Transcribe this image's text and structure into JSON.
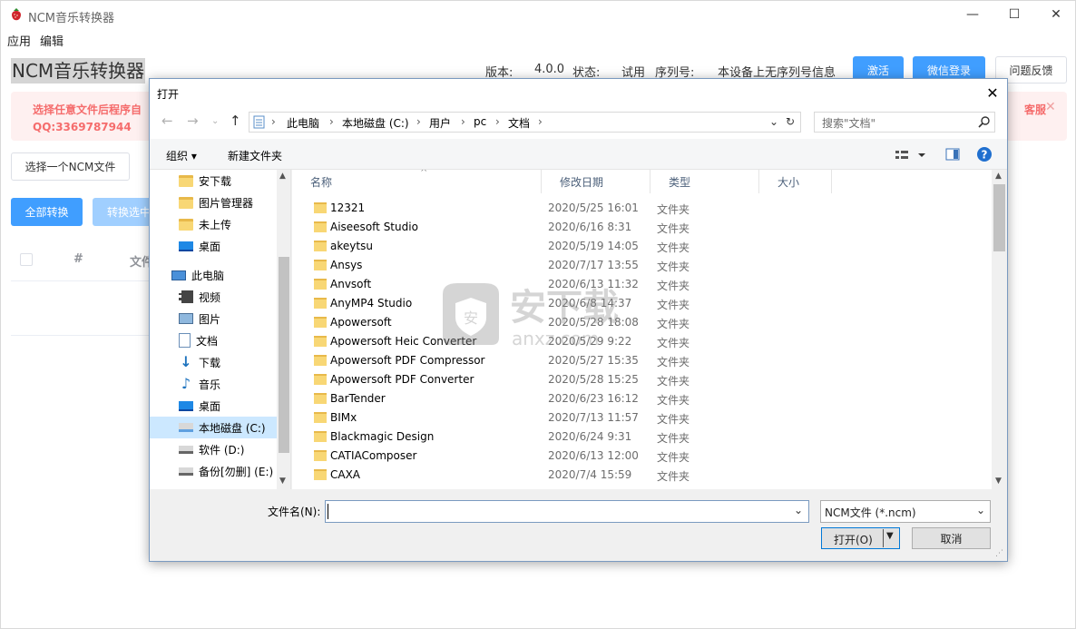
{
  "app": {
    "title": "NCM音乐转换器",
    "heading": "NCM音乐转换器",
    "menu": [
      "应用",
      "编辑"
    ],
    "version_label": "版本:",
    "version_value": "4.0.0",
    "status_label": "状态:",
    "status_value": "试用",
    "serial_label": "序列号:",
    "serial_value": "本设备上无序列号信息",
    "activate_button": "激活",
    "wechat_button": "微信登录",
    "feedback_button": "问题反馈",
    "alert_line1": "选择任意文件后程序自",
    "alert_line2": "QQ:3369787944",
    "alert_right": "客服",
    "select_file_button": "选择一个NCM文件",
    "convert_all_button": "全部转换",
    "convert_selected_button": "转换选中",
    "table_headers": [
      "#",
      "文件"
    ]
  },
  "dialog": {
    "title": "打开",
    "address": [
      "此电脑",
      "本地磁盘 (C:)",
      "用户",
      "pc",
      "文档"
    ],
    "search_placeholder": "搜索\"文档\"",
    "toolbar": {
      "organize": "组织 ▾",
      "new_folder": "新建文件夹"
    },
    "nav_items": [
      {
        "label": "安下载",
        "icon": "folder-icon"
      },
      {
        "label": "图片管理器",
        "icon": "folder-icon"
      },
      {
        "label": "未上传",
        "icon": "folder-icon"
      },
      {
        "label": "桌面",
        "icon": "desktop-icon"
      },
      {
        "label": "此电脑",
        "icon": "computer-icon"
      },
      {
        "label": "视频",
        "icon": "video-icon"
      },
      {
        "label": "图片",
        "icon": "picture-icon"
      },
      {
        "label": "文档",
        "icon": "document-icon"
      },
      {
        "label": "下载",
        "icon": "download-icon"
      },
      {
        "label": "音乐",
        "icon": "music-icon"
      },
      {
        "label": "桌面",
        "icon": "desktop-icon"
      },
      {
        "label": "本地磁盘 (C:)",
        "icon": "drive-icon"
      },
      {
        "label": "软件 (D:)",
        "icon": "drive-icon"
      },
      {
        "label": "备份[勿删] (E:)",
        "icon": "drive-icon"
      }
    ],
    "columns": [
      "名称",
      "修改日期",
      "类型",
      "大小"
    ],
    "files": [
      {
        "name": "12321",
        "date": "2020/5/25 16:01",
        "type": "文件夹"
      },
      {
        "name": "Aiseesoft Studio",
        "date": "2020/6/16 8:31",
        "type": "文件夹"
      },
      {
        "name": "akeytsu",
        "date": "2020/5/19 14:05",
        "type": "文件夹"
      },
      {
        "name": "Ansys",
        "date": "2020/7/17 13:55",
        "type": "文件夹"
      },
      {
        "name": "Anvsoft",
        "date": "2020/6/13 11:32",
        "type": "文件夹"
      },
      {
        "name": "AnyMP4 Studio",
        "date": "2020/6/8 14:37",
        "type": "文件夹"
      },
      {
        "name": "Apowersoft",
        "date": "2020/5/28 18:08",
        "type": "文件夹"
      },
      {
        "name": "Apowersoft Heic Converter",
        "date": "2020/5/29 9:22",
        "type": "文件夹"
      },
      {
        "name": "Apowersoft PDF Compressor",
        "date": "2020/5/27 15:35",
        "type": "文件夹"
      },
      {
        "name": "Apowersoft PDF Converter",
        "date": "2020/5/28 15:25",
        "type": "文件夹"
      },
      {
        "name": "BarTender",
        "date": "2020/6/23 16:12",
        "type": "文件夹"
      },
      {
        "name": "BIMx",
        "date": "2020/7/13 11:57",
        "type": "文件夹"
      },
      {
        "name": "Blackmagic Design",
        "date": "2020/6/24 9:31",
        "type": "文件夹"
      },
      {
        "name": "CATIAComposer",
        "date": "2020/6/13 12:00",
        "type": "文件夹"
      },
      {
        "name": "CAXA",
        "date": "2020/7/4 15:59",
        "type": "文件夹"
      }
    ],
    "filename_label": "文件名(N):",
    "filename_value": "",
    "filetype_value": "NCM文件 (*.ncm)",
    "open_button": "打开(O)",
    "cancel_button": "取消"
  },
  "watermark": {
    "text": "安下载",
    "sub": "anxz.com"
  }
}
